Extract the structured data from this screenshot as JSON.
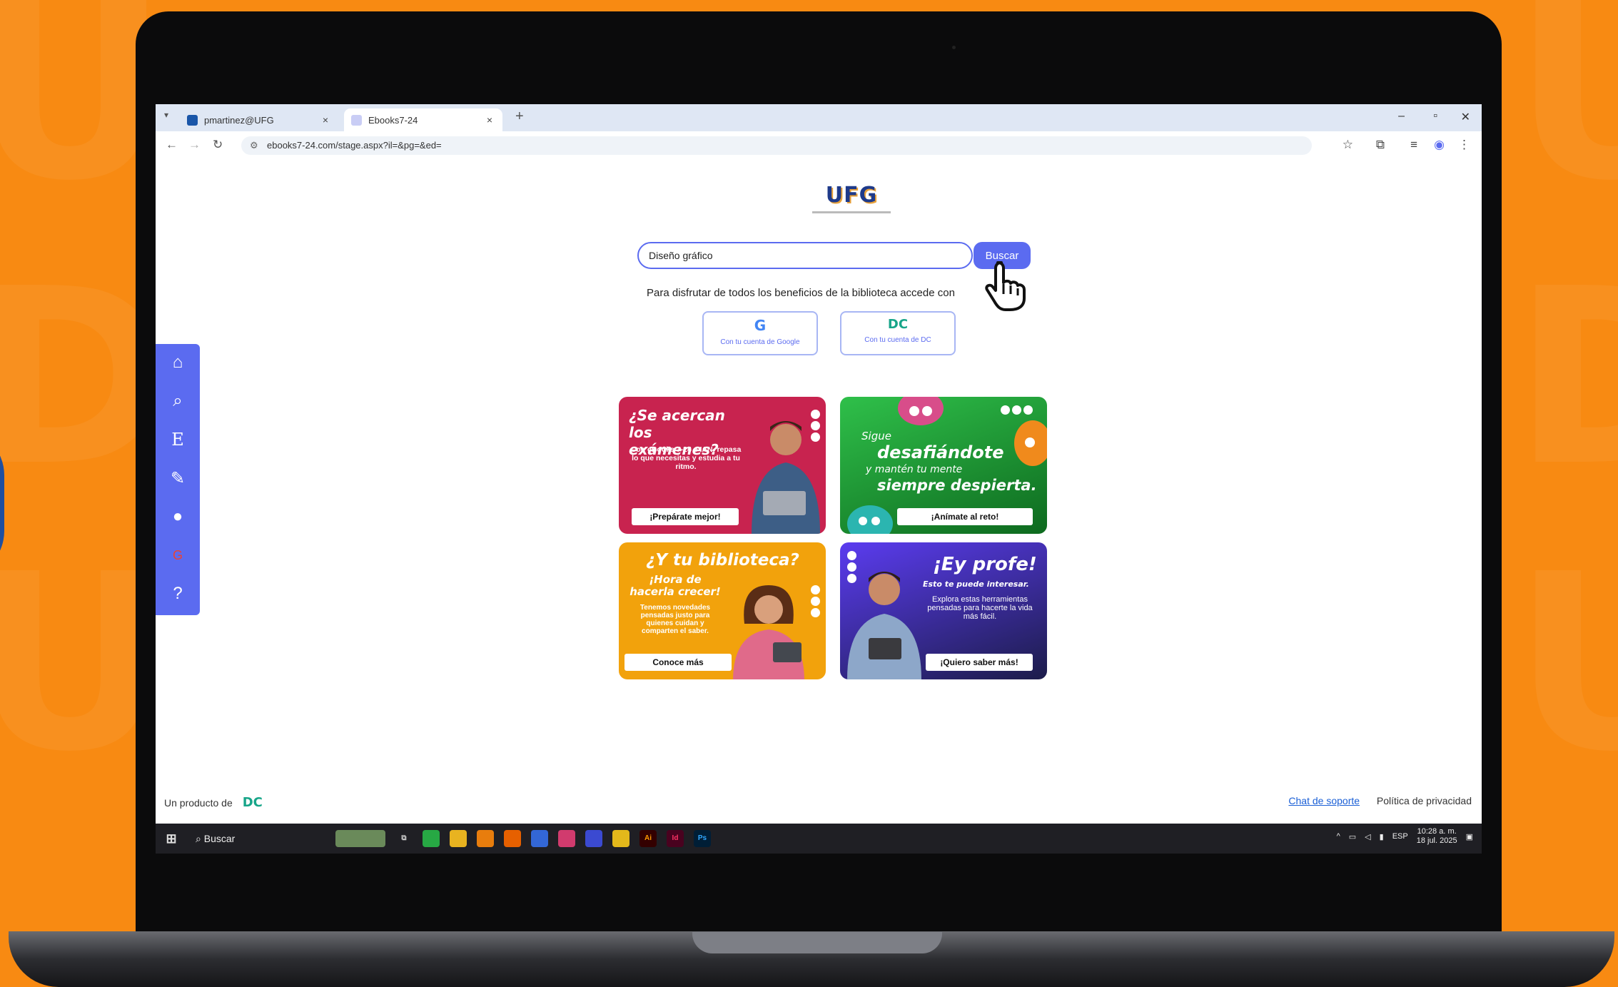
{
  "browser": {
    "tabs": [
      {
        "label": "pmartinez@UFG",
        "close": "×"
      },
      {
        "label": "Ebooks7-24",
        "close": "×"
      }
    ],
    "new_tab": "+",
    "url": "ebooks7-24.com/stage.aspx?il=&pg=&ed=",
    "window_controls": {
      "minimize": "–",
      "maximize": "▫",
      "close": "✕"
    }
  },
  "page": {
    "logo_text": "UFG",
    "search": {
      "value": "Diseño gráfico",
      "button_label": "Buscar"
    },
    "login_note": "Para disfrutar de todos los beneficios de la biblioteca accede con",
    "login_buttons": [
      {
        "mark": "G",
        "label": "Con tu cuenta de Google"
      },
      {
        "mark": "DC",
        "label": "Con tu cuenta de DC"
      }
    ],
    "cards": [
      {
        "title": "¿Se acercan los exámenes?",
        "body": "Con eBooks 7-24 e IAN, repasa lo que necesitas y estudia a tu ritmo.",
        "cta": "¡Prepárate mejor!",
        "color": "#c8234f"
      },
      {
        "pre": "Sigue",
        "title": "desafiándote",
        "sub": "y mantén tu mente",
        "title2": "siempre despierta.",
        "cta": "¡Anímate al reto!",
        "color": "#17a13a"
      },
      {
        "title": "¿Y tu biblioteca?",
        "sub": "¡Hora de hacerla crecer!",
        "body": "Tenemos novedades pensadas justo para quienes cuidan y comparten el saber.",
        "cta": "Conoce más",
        "color": "#f2a20c"
      },
      {
        "title": "¡Ey profe!",
        "sub": "Esto te puede interesar.",
        "body": "Explora estas herramientas pensadas para hacerte la vida más fácil.",
        "cta": "¡Quiero saber más!",
        "color": "#3a2a9a"
      }
    ],
    "sidebar_icons": [
      "home-icon",
      "search-icon",
      "e-icon",
      "edit-icon",
      "chat-icon",
      "google-icon",
      "help-icon"
    ],
    "footer": {
      "producer": "Un producto de",
      "chat": "Chat de soporte",
      "privacy": "Política de privacidad"
    }
  },
  "taskbar": {
    "search_label": "Buscar",
    "lang": "ESP",
    "time": "10:28 a. m.",
    "date": "18 jul. 2025"
  },
  "colors": {
    "accent": "#5b6bf0",
    "background": "#f88a12"
  }
}
